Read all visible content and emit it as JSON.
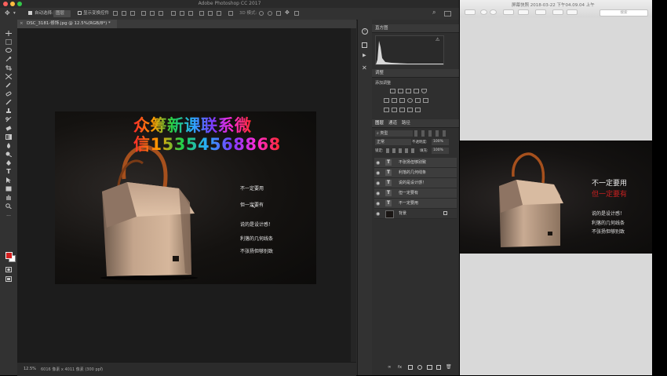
{
  "photoshop": {
    "app_title": "Adobe Photoshop CC 2017",
    "options_bar": {
      "auto_select_label": "自动选择:",
      "auto_select_value": "图层",
      "show_transform_label": "显示变换控件",
      "mode_3d_label": "3D 模式:"
    },
    "document_tab": "DSC_3181-修饰.jpg @ 12.5%(RGB/8*) *",
    "canvas": {
      "watermark_line1": "众筹新课联系微",
      "watermark_line2": "信15354568868",
      "text_lines": [
        "不一定要用",
        "但一定要有",
        "说的是设计感！",
        "利落的几何线条",
        "不张扬但够别致"
      ]
    },
    "status": {
      "zoom": "12.5%",
      "doc_info": "6016 像素 x 4011 像素 (300 ppi)"
    },
    "panels": {
      "histogram_title": "直方图",
      "adjustments_title": "调整",
      "add_adjustment_label": "添加调整",
      "layers_tabs": [
        "图层",
        "通道",
        "路径"
      ],
      "filter_kind": "类型",
      "blend_mode": "正常",
      "opacity_label": "不透明度:",
      "opacity_value": "100%",
      "lock_label": "锁定:",
      "fill_label": "填充:",
      "fill_value": "100%",
      "layers": [
        {
          "name": "不张扬但够别致",
          "type": "T"
        },
        {
          "name": "利落的几何线条",
          "type": "T"
        },
        {
          "name": "说的是设计感！",
          "type": "T"
        },
        {
          "name": "但一定要有",
          "type": "T"
        },
        {
          "name": "不一定要用",
          "type": "T"
        },
        {
          "name": "背景",
          "type": "image"
        }
      ]
    }
  },
  "preview": {
    "window_title": "屏幕快照 2018-03-22 下午04.09.04 上午",
    "search_placeholder": "搜索",
    "image_text": {
      "line1": "不一定要用",
      "line2": "但一定要有",
      "line3": "说的是设计感！",
      "line4": "利落的几何线条",
      "line5": "不张扬但够别致"
    }
  },
  "colors": {
    "ps_bg": "#2b2b2b",
    "canvas_bg": "#1c1c1c",
    "foreground_swatch": "#d42020",
    "background_swatch": "#ffffff",
    "mac_close": "#fc605c",
    "mac_min": "#fdbc40",
    "mac_max": "#34c84a"
  }
}
